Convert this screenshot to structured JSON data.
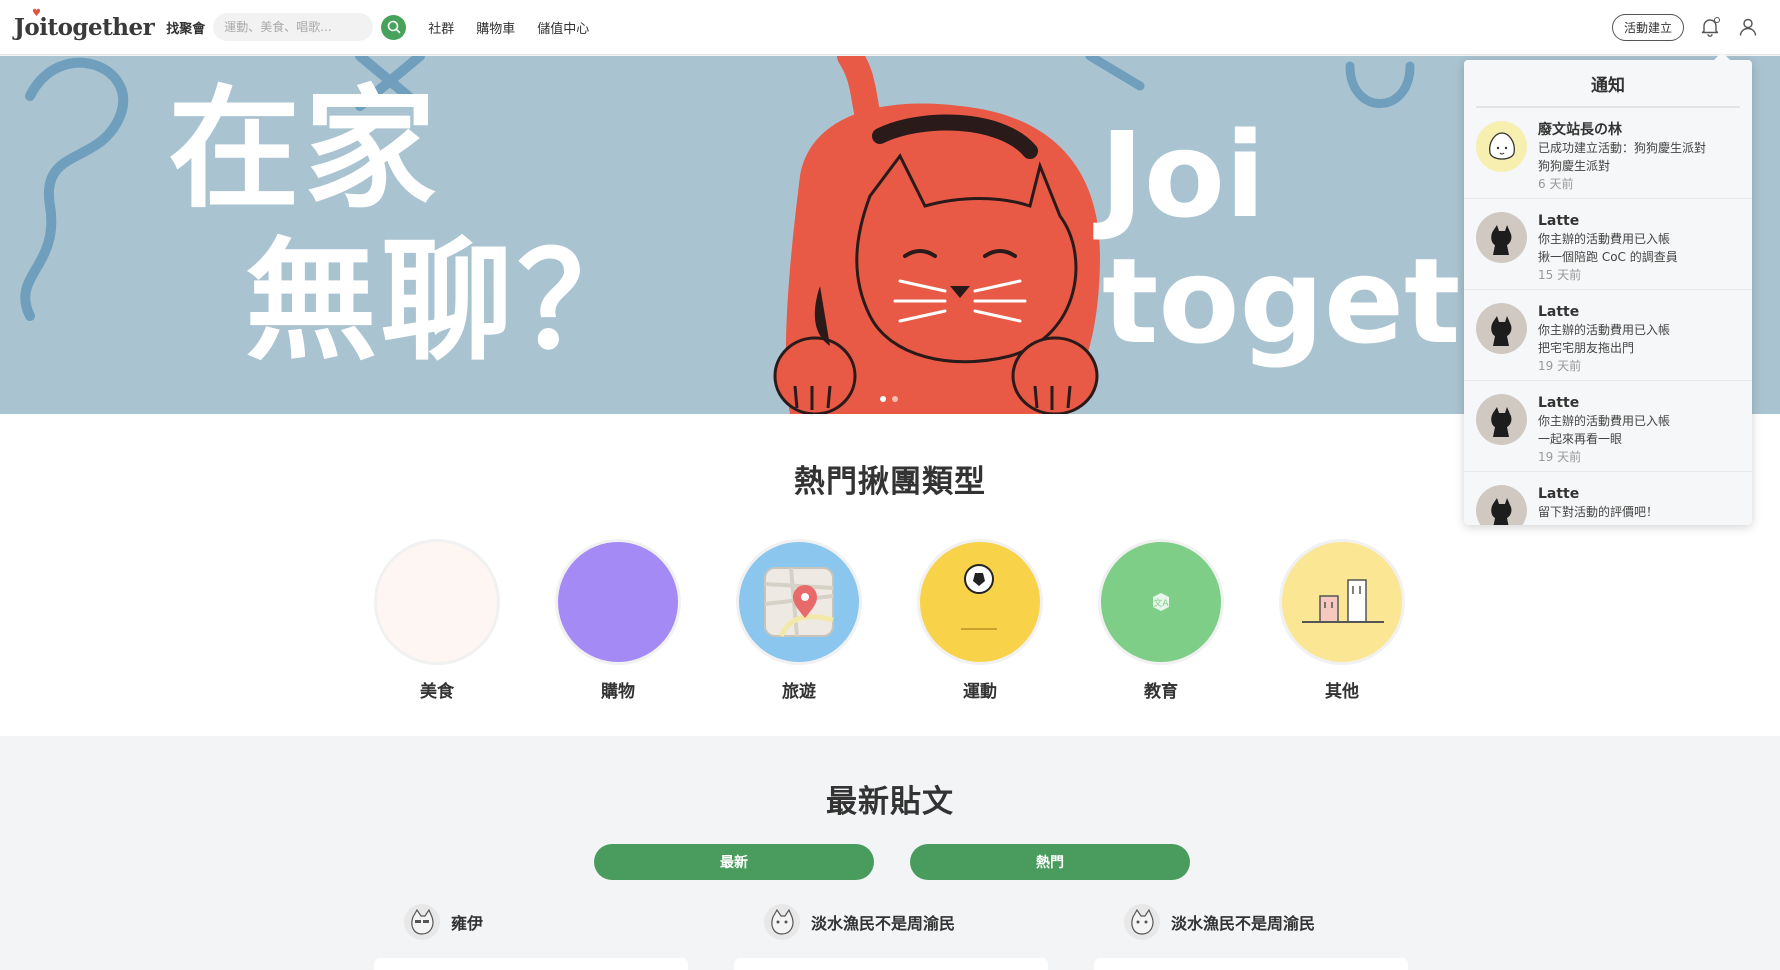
{
  "header": {
    "logo": "Joitogether",
    "find_label": "找聚會",
    "search_placeholder": "運動、美食、唱歌...",
    "nav": [
      "社群",
      "購物車",
      "儲值中心"
    ],
    "create_label": "活動建立"
  },
  "hero": {
    "line1": "在家",
    "line2": "無聊？",
    "en1": "Joi",
    "en2": "togeth"
  },
  "categories": {
    "title": "熱門揪團類型",
    "items": [
      {
        "label": "美食",
        "color": "#fdf6f2"
      },
      {
        "label": "購物",
        "color": "#a48af5"
      },
      {
        "label": "旅遊",
        "color": "#8bc6ee"
      },
      {
        "label": "運動",
        "color": "#f8d34a"
      },
      {
        "label": "教育",
        "color": "#7fce88"
      },
      {
        "label": "其他",
        "color": "#fbe693"
      }
    ]
  },
  "posts": {
    "title": "最新貼文",
    "tabs": [
      "最新",
      "熱門"
    ],
    "authors": [
      "雍伊",
      "淡水漁民不是周渝民",
      "淡水漁民不是周渝民"
    ]
  },
  "notifications": {
    "title": "通知",
    "items": [
      {
        "name": "廢文站長の林",
        "line1": "已成功建立活動：狗狗慶生派對",
        "line2": "狗狗慶生派對",
        "time": "6 天前"
      },
      {
        "name": "Latte",
        "line1": "你主辦的活動費用已入帳",
        "line2": "揪一個陪跑 CoC 的調查員",
        "time": "15 天前"
      },
      {
        "name": "Latte",
        "line1": "你主辦的活動費用已入帳",
        "line2": "把宅宅朋友拖出門",
        "time": "19 天前"
      },
      {
        "name": "Latte",
        "line1": "你主辦的活動費用已入帳",
        "line2": "一起來再看一眼",
        "time": "19 天前"
      },
      {
        "name": "Latte",
        "line1": "留下對活動的評價吧！",
        "line2": "",
        "time": ""
      }
    ]
  }
}
